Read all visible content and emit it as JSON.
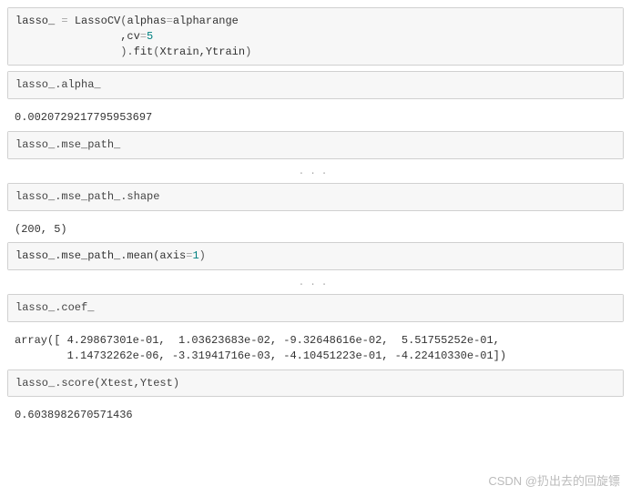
{
  "cells": {
    "c1": {
      "line1": "lasso_ = LassoCV(alphas=alpharange",
      "line2": "                ,cv=5",
      "line3": "                ).fit(Xtrain,Ytrain)",
      "tokens": {
        "lasso_": "lasso_",
        "eq": " = ",
        "LassoCV": "LassoCV",
        "lp": "(",
        "alphas": "alphas",
        "keq": "=",
        "alpharange": "alpharange",
        "comma_cv": "                ,cv",
        "five": "5",
        "line3_pre": "                ).",
        "fit": "fit",
        "xtr": "Xtrain,Ytrain",
        "rp": ")"
      }
    },
    "c2": {
      "code": "lasso_.alpha_"
    },
    "o2": {
      "text": "0.0020729217795953697"
    },
    "c3": {
      "code": "lasso_.mse_path_"
    },
    "c4": {
      "code": "lasso_.mse_path_.shape"
    },
    "o4": {
      "text": "(200, 5)"
    },
    "c5": {
      "pre": "lasso_.mse_path_.mean(axis",
      "eq": "=",
      "one": "1",
      "rp": ")"
    },
    "c6": {
      "code": "lasso_.coef_"
    },
    "o6": {
      "line1": "array([ 4.29867301e-01,  1.03623683e-02, -9.32648616e-02,  5.51755252e-01,",
      "line2": "        1.14732262e-06, -3.31941716e-03, -4.10451223e-01, -4.22410330e-01])"
    },
    "c7": {
      "code": "lasso_.score(Xtest,Ytest)"
    },
    "o7": {
      "text": "0.6038982670571436"
    }
  },
  "ellipsis": "...",
  "watermark": "CSDN @扔出去的回旋镖",
  "chart_data": {
    "type": "table",
    "note": "Notebook outputs as data",
    "alpha_": 0.0020729217795953697,
    "mse_path_shape": [
      200,
      5
    ],
    "coef_": [
      0.429867301,
      0.0103623683,
      -0.0932648616,
      0.551755252,
      1.14732262e-06,
      -0.00331941716,
      -0.410451223,
      -0.42241033
    ],
    "score": 0.6038982670571436
  }
}
